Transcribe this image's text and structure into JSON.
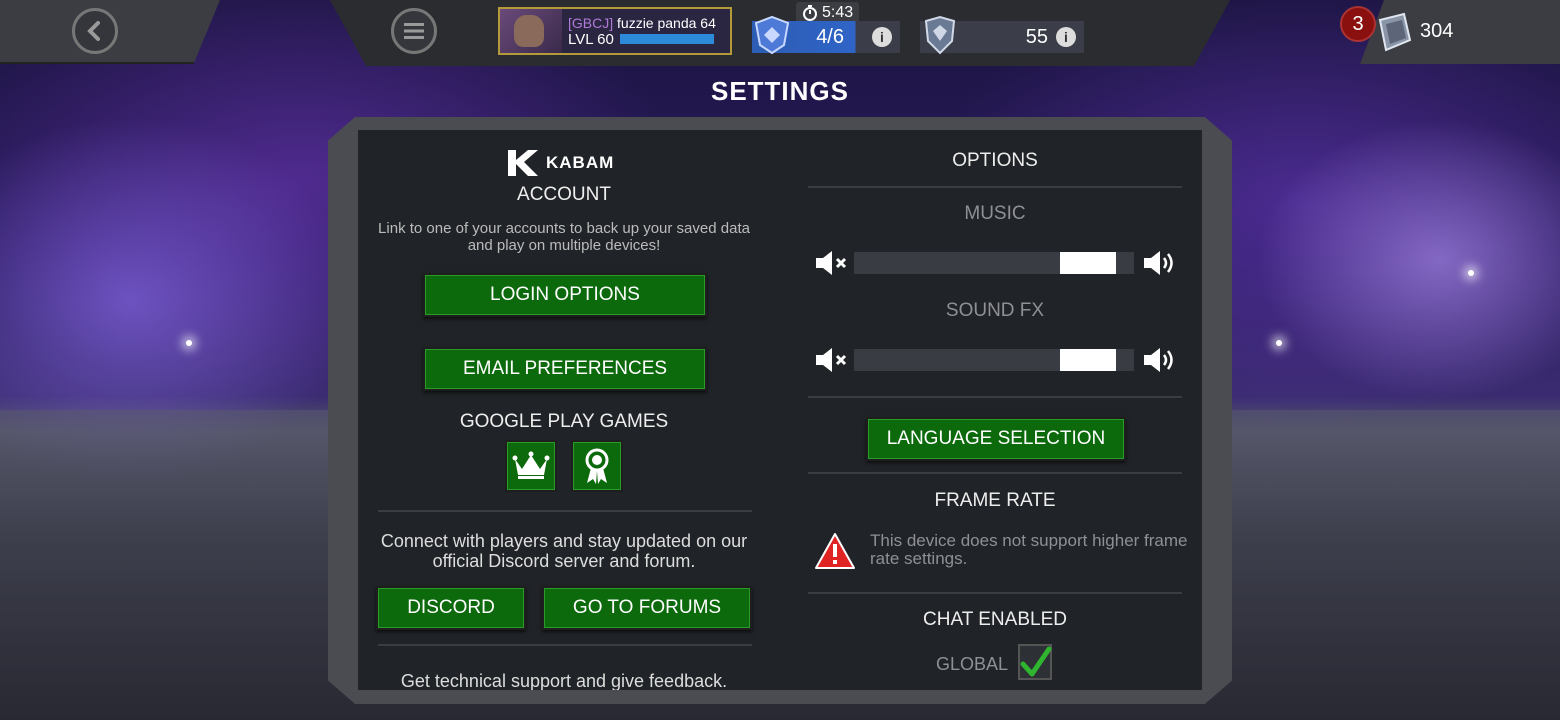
{
  "header": {
    "player": {
      "tag": "[GBCJ]",
      "name": "fuzzie panda 64",
      "level": "LVL 60"
    },
    "timer": "5:43",
    "energy": {
      "value": "4/6"
    },
    "shields": {
      "value": "55"
    },
    "notifications": "3",
    "units": "304"
  },
  "page_title": "SETTINGS",
  "account": {
    "brand": "KABAM",
    "heading": "ACCOUNT",
    "description": "Link to one of your accounts to back up your saved data and play on multiple devices!",
    "login_button": "LOGIN OPTIONS",
    "email_button": "EMAIL PREFERENCES",
    "google_heading": "GOOGLE PLAY GAMES",
    "community_text": "Connect with players and stay updated on our official Discord server and forum.",
    "discord_button": "DISCORD",
    "forums_button": "GO TO FORUMS",
    "support_text": "Get technical support and give feedback."
  },
  "options": {
    "heading": "OPTIONS",
    "music_label": "MUSIC",
    "music_level": 0.92,
    "sfx_label": "SOUND FX",
    "sfx_level": 0.92,
    "language_button": "LANGUAGE SELECTION",
    "frame_rate_heading": "FRAME RATE",
    "frame_rate_note": "This device does not support higher frame rate settings.",
    "chat_heading": "CHAT ENABLED",
    "global_label": "GLOBAL",
    "global_checked": true
  },
  "colors": {
    "button_green": "#0c6a0c",
    "panel": "#202327",
    "xp_bar": "#2d8ad8"
  }
}
